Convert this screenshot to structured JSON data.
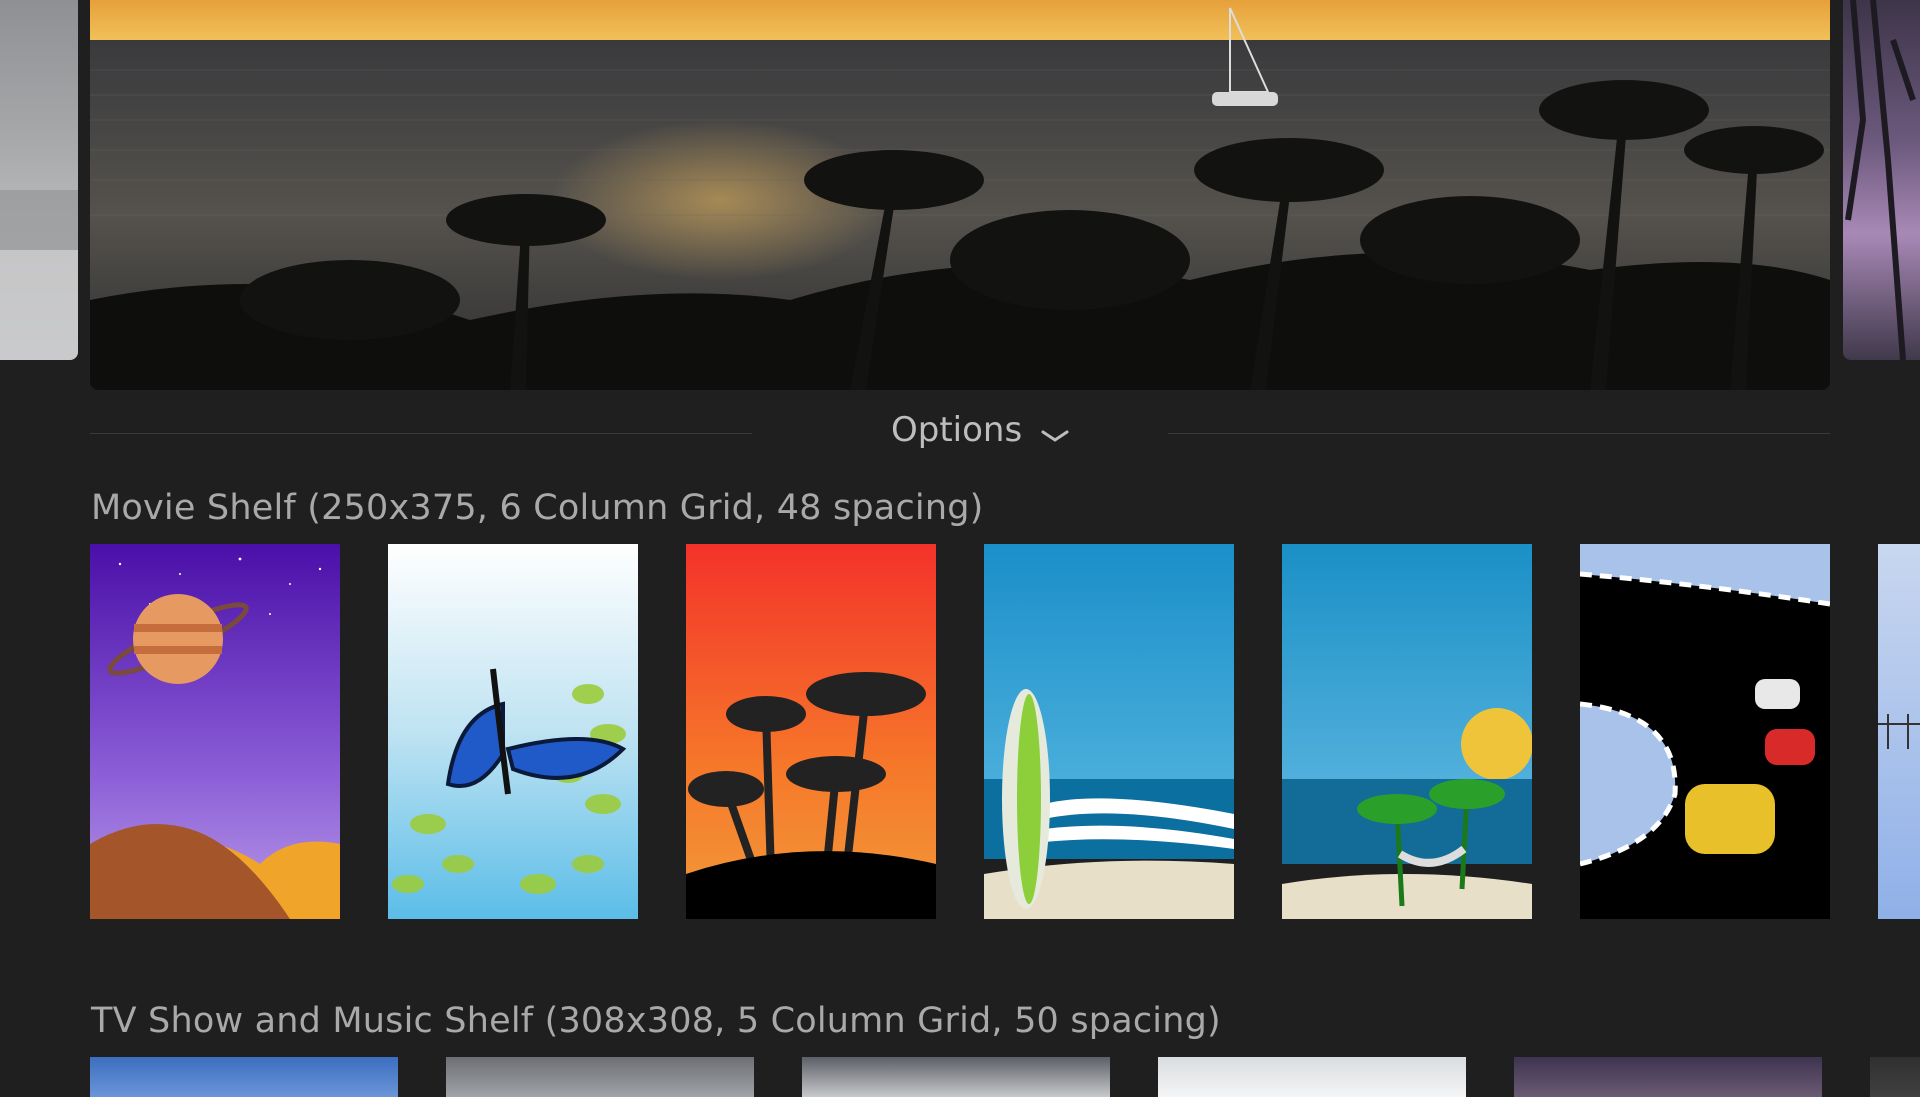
{
  "options": {
    "label": "Options"
  },
  "movie_shelf": {
    "title": "Movie Shelf (250x375, 6 Column Grid, 48 spacing)",
    "items": [
      {
        "name": "planet",
        "colors": [
          "#4a0fa8",
          "#8a5cd6",
          "#b99be8"
        ]
      },
      {
        "name": "butterfly",
        "colors": [
          "#ffffff",
          "#bfe3f2",
          "#5bbde8"
        ]
      },
      {
        "name": "palm-silhouette",
        "colors": [
          "#f3322a",
          "#f6782a",
          "#f29b3a"
        ]
      },
      {
        "name": "surfboard-beach",
        "colors": [
          "#1a8fc9",
          "#4aaedb",
          "#e8dfc9"
        ]
      },
      {
        "name": "hammock-beach",
        "colors": [
          "#1a90c6",
          "#52b0dc",
          "#e8dfc9"
        ]
      },
      {
        "name": "race-track",
        "colors": [
          "#000000",
          "#a9c2ea",
          "#e8c02a"
        ]
      },
      {
        "name": "bridge-partial",
        "colors": [
          "#c9d7ef",
          "#8fb0e8"
        ]
      }
    ]
  },
  "tv_shelf": {
    "title": "TV Show and Music Shelf (308x308, 5 Column Grid, 50 spacing)",
    "items": [
      {
        "name": "sky-blue",
        "colors": [
          "#3c6ec0",
          "#6b95d8"
        ]
      },
      {
        "name": "clouds-gray",
        "colors": [
          "#6d6f74",
          "#a0a3a8"
        ]
      },
      {
        "name": "storm-clouds",
        "colors": [
          "#5c5f66",
          "#c7c9cc"
        ]
      },
      {
        "name": "bright-clouds",
        "colors": [
          "#d9dcdf",
          "#f4f5f6"
        ]
      },
      {
        "name": "dusk",
        "colors": [
          "#3e3450",
          "#6b5a74"
        ]
      },
      {
        "name": "partial",
        "colors": [
          "#303030",
          "#404040"
        ]
      }
    ]
  }
}
